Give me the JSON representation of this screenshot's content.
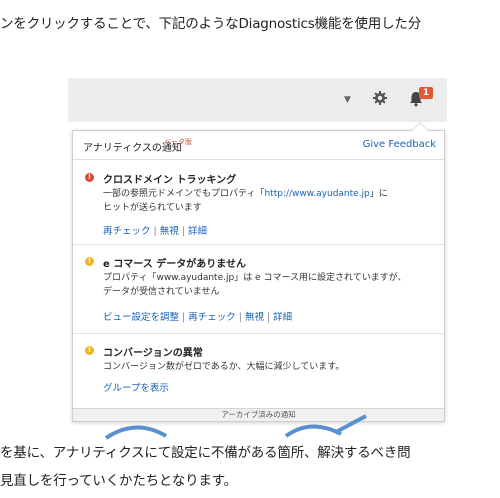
{
  "article": {
    "top_line": "ンをクリックすることで、下記のようなDiagnostics機能を使用した分",
    "bottom_line1": "を基に、アナリティクスにて設定に不備がある箇所、解決するべき問",
    "bottom_line2": "見直しを行っていくかたちとなります。"
  },
  "toolbar": {
    "dropdown_icon": "chevron-down-icon",
    "settings_icon": "gear-icon",
    "notifications_icon": "bell-icon",
    "notification_count": "1"
  },
  "panel": {
    "title": "アナリティクスの通知",
    "beta": "ベータ版",
    "feedback": "Give Feedback",
    "archive": "アーカイブ済みの通知"
  },
  "notifications": [
    {
      "severity": "error",
      "icon": "!",
      "title": "クロスドメイン トラッキング",
      "body_pre": "一部の参照元ドメインでもプロパティ「",
      "body_url": "http://www.ayudante.jp",
      "body_post": "」に",
      "body_line2": "ヒットが送られています",
      "links": [
        "再チェック",
        "無視",
        "詳細"
      ]
    },
    {
      "severity": "warning",
      "icon": "!",
      "title": "e コマース データがありません",
      "body_line1": "プロパティ「www.ayudante.jp」は e コマース用に設定されていますが、",
      "body_line2": "データが受信されていません",
      "links": [
        "ビュー設定を調整",
        "再チェック",
        "無視",
        "詳細"
      ]
    },
    {
      "severity": "warning",
      "icon": "!",
      "title": "コンバージョンの異常",
      "body_line1": "コンバージョン数がゼロであるか、大幅に減少しています。",
      "links": [
        "グループを表示"
      ]
    }
  ],
  "colors": {
    "link": "#1a63b5",
    "error": "#d9483a",
    "warning": "#f0b429",
    "badge": "#e05a38"
  }
}
